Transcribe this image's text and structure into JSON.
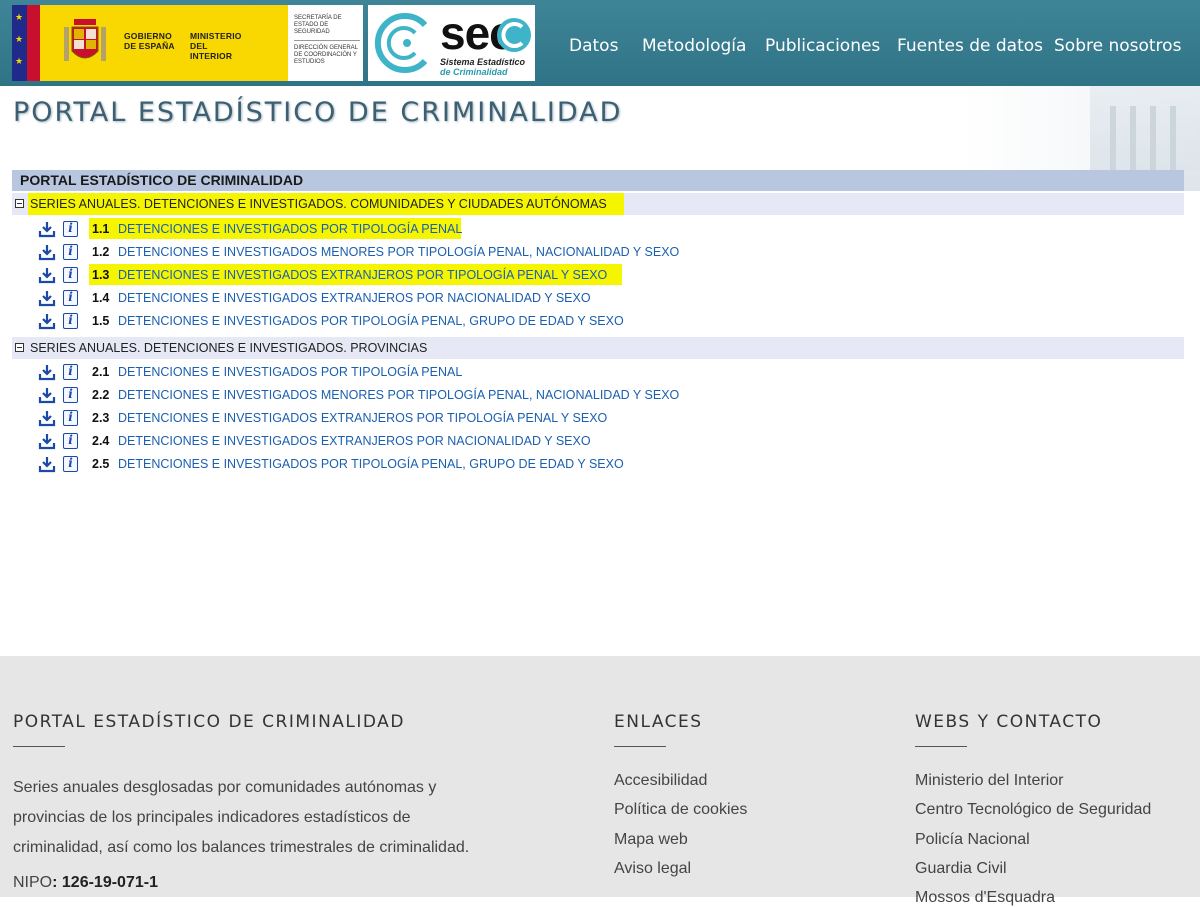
{
  "header": {
    "gov_logo": {
      "line1": "GOBIERNO",
      "line2": "DE ESPAÑA",
      "ministry1": "MINISTERIO",
      "ministry2": "DEL INTERIOR",
      "secretaria": "SECRETARÍA DE ESTADO DE SEGURIDAD",
      "direccion": "DIRECCIÓN GENERAL DE COORDINACIÓN Y ESTUDIOS"
    },
    "sec_logo": {
      "big": "sec",
      "sub1": "Sistema Estadístico",
      "sub2": "de Criminalidad"
    },
    "nav": [
      "Datos",
      "Metodología",
      "Publicaciones",
      "Fuentes de datos",
      "Sobre nosotros"
    ]
  },
  "page_title": "PORTAL ESTADÍSTICO DE CRIMINALIDAD",
  "tree": {
    "header": "PORTAL ESTADÍSTICO DE CRIMINALIDAD",
    "groups": [
      {
        "label": "SERIES ANUALES. DETENCIONES E INVESTIGADOS. COMUNIDADES Y CIUDADES AUTÓNOMAS",
        "items": [
          {
            "num": "1.1",
            "label": "DETENCIONES E INVESTIGADOS POR TIPOLOGÍA PENAL"
          },
          {
            "num": "1.2",
            "label": "DETENCIONES E INVESTIGADOS MENORES POR TIPOLOGÍA PENAL, NACIONALIDAD Y SEXO"
          },
          {
            "num": "1.3",
            "label": "DETENCIONES E INVESTIGADOS EXTRANJEROS POR TIPOLOGÍA PENAL Y SEXO"
          },
          {
            "num": "1.4",
            "label": "DETENCIONES E INVESTIGADOS EXTRANJEROS POR NACIONALIDAD Y SEXO"
          },
          {
            "num": "1.5",
            "label": "DETENCIONES E INVESTIGADOS POR TIPOLOGÍA PENAL, GRUPO DE EDAD Y SEXO"
          }
        ]
      },
      {
        "label": "SERIES ANUALES. DETENCIONES E INVESTIGADOS. PROVINCIAS",
        "items": [
          {
            "num": "2.1",
            "label": "DETENCIONES E INVESTIGADOS POR TIPOLOGÍA PENAL"
          },
          {
            "num": "2.2",
            "label": "DETENCIONES E INVESTIGADOS MENORES POR TIPOLOGÍA PENAL, NACIONALIDAD Y SEXO"
          },
          {
            "num": "2.3",
            "label": "DETENCIONES E INVESTIGADOS EXTRANJEROS POR TIPOLOGÍA PENAL Y SEXO"
          },
          {
            "num": "2.4",
            "label": "DETENCIONES E INVESTIGADOS EXTRANJEROS POR NACIONALIDAD Y SEXO"
          },
          {
            "num": "2.5",
            "label": "DETENCIONES E INVESTIGADOS POR TIPOLOGÍA PENAL, GRUPO DE EDAD Y SEXO"
          }
        ]
      }
    ]
  },
  "footer": {
    "col1_title": "PORTAL ESTADÍSTICO DE CRIMINALIDAD",
    "description": "Series anuales desglosadas por comunidades autónomas y provincias de los principales indicadores estadísticos de criminalidad, así como los balances trimestrales de criminalidad.",
    "nipo_label": "NIPO",
    "nipo_value": ": 126-19-071-1",
    "col2_title": "ENLACES",
    "links": [
      "Accesibilidad",
      "Política de cookies",
      "Mapa web",
      "Aviso legal"
    ],
    "col3_title": "WEBS Y CONTACTO",
    "contacts": [
      "Ministerio del Interior",
      "Centro Tecnológico de Seguridad",
      "Policía Nacional",
      "Guardia Civil",
      "Mossos d'Esquadra"
    ]
  },
  "colors": {
    "header_bg": "#3e8597",
    "highlight": "#f6f500",
    "link": "#1b5fb0",
    "footer_bg": "#e6e6e6"
  }
}
